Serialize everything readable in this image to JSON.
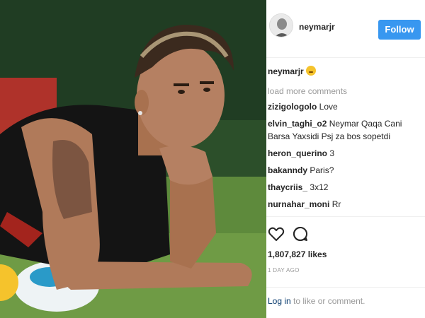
{
  "post": {
    "image_alt": "Footballer lying on training grass, chin resting on hand",
    "author": {
      "username": "neymarjr",
      "follow_label": "Follow"
    },
    "caption": {
      "username": "neymarjr"
    },
    "load_more_label": "load more comments",
    "comments": [
      {
        "username": "zizigologolo",
        "text": "Love"
      },
      {
        "username": "elvin_taghi_o2",
        "text": "Neymar Qaqa Cani Barsa Yaxsidi Psj za bos sopetdi"
      },
      {
        "username": "heron_querino",
        "text": "3"
      },
      {
        "username": "bakanndy",
        "text": "Paris?"
      },
      {
        "username": "thaycriis_",
        "text": "3x12"
      },
      {
        "username": "nurnahar_moni",
        "text": "Rr"
      }
    ],
    "likes": "1,807,827 likes",
    "timestamp": "1 DAY AGO",
    "login": {
      "link_label": "Log in",
      "rest": "to like or comment."
    }
  },
  "icons": {
    "like": "heart-outline-icon",
    "comment": "speech-bubble-icon"
  },
  "colors": {
    "follow_button": "#3897f0",
    "muted_text": "#999999",
    "link": "#003569"
  }
}
